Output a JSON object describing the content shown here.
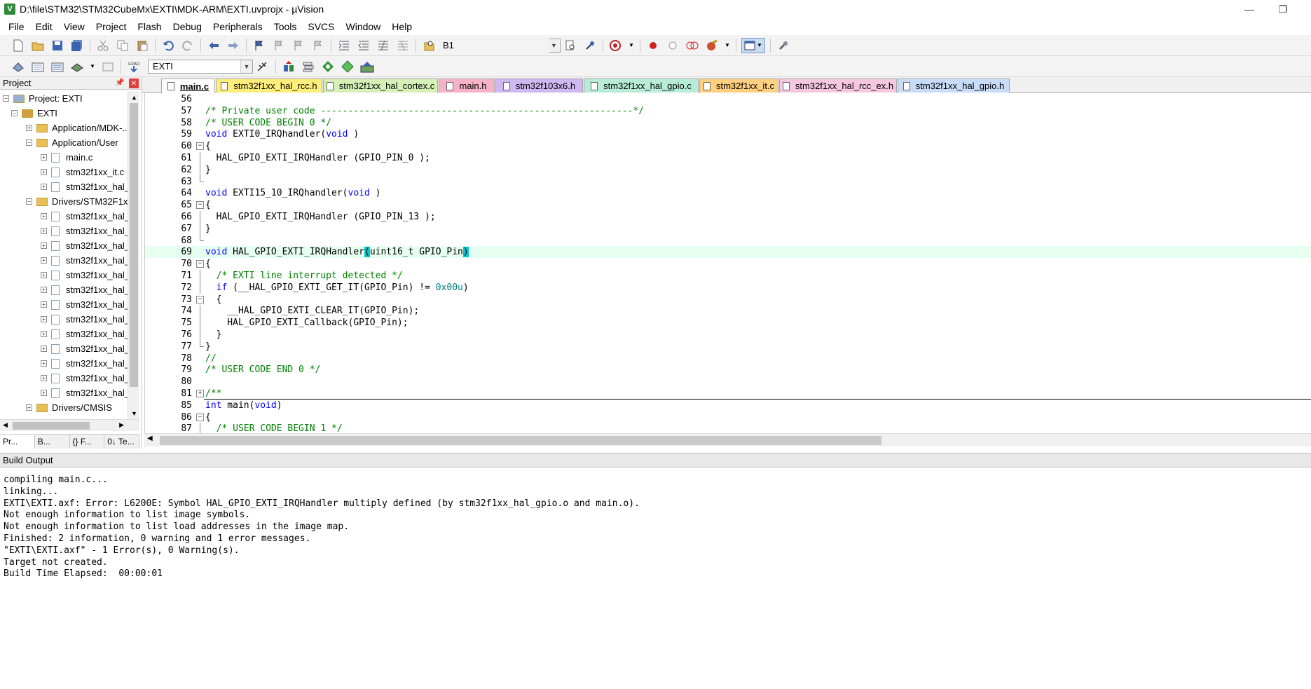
{
  "window": {
    "title": "D:\\file\\STM32\\STM32CubeMx\\EXTI\\MDK-ARM\\EXTI.uvprojx - µVision",
    "minimize": "—",
    "restore": "❐"
  },
  "menu": [
    "File",
    "Edit",
    "View",
    "Project",
    "Flash",
    "Debug",
    "Peripherals",
    "Tools",
    "SVCS",
    "Window",
    "Help"
  ],
  "toolbar1": {
    "target_label": "B1"
  },
  "toolbar2": {
    "target_select": "EXTI"
  },
  "project_panel": {
    "title": "Project",
    "tree": [
      {
        "label": "Project: EXTI",
        "type": "root",
        "exp": "−"
      },
      {
        "label": "EXTI",
        "type": "target",
        "exp": "−"
      },
      {
        "label": "Application/MDK-...",
        "type": "folder",
        "exp": "+"
      },
      {
        "label": "Application/User",
        "type": "folder",
        "exp": "−"
      },
      {
        "label": "main.c",
        "type": "file",
        "exp": "+"
      },
      {
        "label": "stm32f1xx_it.c",
        "type": "file",
        "exp": "+"
      },
      {
        "label": "stm32f1xx_hal_...",
        "type": "file",
        "exp": "+"
      },
      {
        "label": "Drivers/STM32F1xx...",
        "type": "folder",
        "exp": "−"
      },
      {
        "label": "stm32f1xx_hal_...",
        "type": "file",
        "exp": "+"
      },
      {
        "label": "stm32f1xx_hal_...",
        "type": "file",
        "exp": "+"
      },
      {
        "label": "stm32f1xx_hal_...",
        "type": "file",
        "exp": "+"
      },
      {
        "label": "stm32f1xx_hal_...",
        "type": "file",
        "exp": "+"
      },
      {
        "label": "stm32f1xx_hal_...",
        "type": "file",
        "exp": "+"
      },
      {
        "label": "stm32f1xx_hal_...",
        "type": "file",
        "exp": "+"
      },
      {
        "label": "stm32f1xx_hal_...",
        "type": "file",
        "exp": "+"
      },
      {
        "label": "stm32f1xx_hal_...",
        "type": "file",
        "exp": "+"
      },
      {
        "label": "stm32f1xx_hal_...",
        "type": "file",
        "exp": "+"
      },
      {
        "label": "stm32f1xx_hal_...",
        "type": "file",
        "exp": "+"
      },
      {
        "label": "stm32f1xx_hal_...",
        "type": "file",
        "exp": "+"
      },
      {
        "label": "stm32f1xx_hal_...",
        "type": "file",
        "exp": "+"
      },
      {
        "label": "stm32f1xx_hal_...",
        "type": "file",
        "exp": "+"
      },
      {
        "label": "Drivers/CMSIS",
        "type": "folder",
        "exp": "+"
      }
    ],
    "tabs": [
      "Pr...",
      "B...",
      "{} F...",
      "0↓ Te..."
    ]
  },
  "file_tabs": [
    {
      "label": "main.c",
      "active": true,
      "color": "#ffffff"
    },
    {
      "label": "stm32f1xx_hal_rcc.h",
      "active": false,
      "color": "#ffef7a"
    },
    {
      "label": "stm32f1xx_hal_cortex.c",
      "active": false,
      "color": "#d6f0b8"
    },
    {
      "label": "main.h",
      "active": false,
      "color": "#f6b3c8"
    },
    {
      "label": "stm32f103x6.h",
      "active": false,
      "color": "#d0b8f0"
    },
    {
      "label": "stm32f1xx_hal_gpio.c",
      "active": false,
      "color": "#b8ecd8"
    },
    {
      "label": "stm32f1xx_it.c",
      "active": false,
      "color": "#ffd080"
    },
    {
      "label": "stm32f1xx_hal_rcc_ex.h",
      "active": false,
      "color": "#f6c8e0"
    },
    {
      "label": "stm32f1xx_hal_gpio.h",
      "active": false,
      "color": "#c8dcf8"
    }
  ],
  "code_lines": [
    {
      "n": "56",
      "text": ""
    },
    {
      "n": "57",
      "text": "/* Private user code ---------------------------------------------------------*/"
    },
    {
      "n": "58",
      "text": "/* USER CODE BEGIN 0 */"
    },
    {
      "n": "59",
      "text": "void EXTI0_IRQhandler(void )"
    },
    {
      "n": "60",
      "text": "{"
    },
    {
      "n": "61",
      "text": "  HAL_GPIO_EXTI_IRQHandler (GPIO_PIN_0 );"
    },
    {
      "n": "62",
      "text": "}"
    },
    {
      "n": "63",
      "text": ""
    },
    {
      "n": "64",
      "text": "void EXTI15_10_IRQhandler(void )"
    },
    {
      "n": "65",
      "text": "{"
    },
    {
      "n": "66",
      "text": "  HAL_GPIO_EXTI_IRQHandler (GPIO_PIN_13 );"
    },
    {
      "n": "67",
      "text": "}"
    },
    {
      "n": "68",
      "text": ""
    },
    {
      "n": "69",
      "text": "void HAL_GPIO_EXTI_IRQHandler(uint16_t GPIO_Pin)"
    },
    {
      "n": "70",
      "text": "{"
    },
    {
      "n": "71",
      "text": "  /* EXTI line interrupt detected */"
    },
    {
      "n": "72",
      "text": "  if (__HAL_GPIO_EXTI_GET_IT(GPIO_Pin) != 0x00u)"
    },
    {
      "n": "73",
      "text": "  {"
    },
    {
      "n": "74",
      "text": "    __HAL_GPIO_EXTI_CLEAR_IT(GPIO_Pin);"
    },
    {
      "n": "75",
      "text": "    HAL_GPIO_EXTI_Callback(GPIO_Pin);"
    },
    {
      "n": "76",
      "text": "  }"
    },
    {
      "n": "77",
      "text": "}"
    },
    {
      "n": "78",
      "text": "//"
    },
    {
      "n": "79",
      "text": "/* USER CODE END 0 */"
    },
    {
      "n": "80",
      "text": ""
    },
    {
      "n": "81",
      "text": "/**"
    },
    {
      "n": "85",
      "text": "int main(void)"
    },
    {
      "n": "86",
      "text": "{"
    },
    {
      "n": "87",
      "text": "  /* USER CODE BEGIN 1 */"
    }
  ],
  "build_output": {
    "title": "Build Output",
    "lines": [
      "compiling main.c...",
      "linking...",
      "EXTI\\EXTI.axf: Error: L6200E: Symbol HAL_GPIO_EXTI_IRQHandler multiply defined (by stm32f1xx_hal_gpio.o and main.o).",
      "Not enough information to list image symbols.",
      "Not enough information to list load addresses in the image map.",
      "Finished: 2 information, 0 warning and 1 error messages.",
      "\"EXTI\\EXTI.axf\" - 1 Error(s), 0 Warning(s).",
      "Target not created.",
      "Build Time Elapsed:  00:00:01"
    ]
  }
}
